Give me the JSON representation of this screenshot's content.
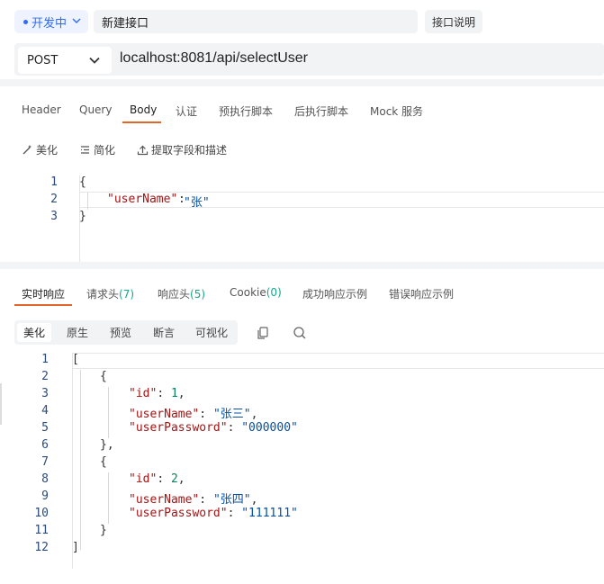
{
  "environment": {
    "label": "开发中",
    "accent": "#2f6cf6"
  },
  "request": {
    "name": "新建接口",
    "doc_label": "接口说明",
    "method": "POST",
    "url": "localhost:8081/api/selectUser"
  },
  "request_tabs": {
    "items": [
      "Header",
      "Query",
      "Body",
      "认证",
      "预执行脚本",
      "后执行脚本",
      "Mock 服务"
    ],
    "active": "Body",
    "accent": "#e0662a"
  },
  "body_toolbar": {
    "beautify": "美化",
    "simplify": "简化",
    "extract": "提取字段和描述"
  },
  "request_body": {
    "line_numbers": [
      "1",
      "2",
      "3"
    ],
    "open": "{",
    "key": "\"userName\"",
    "colon": ":",
    "value": "\"张\"",
    "close": "}"
  },
  "response_tabs": {
    "realtime": "实时响应",
    "req_headers": "请求头",
    "req_headers_count": "7",
    "res_headers": "响应头",
    "res_headers_count": "5",
    "cookie": "Cookie",
    "cookie_count": "0",
    "success_example": "成功响应示例",
    "error_example": "错误响应示例"
  },
  "view_modes": {
    "items": [
      "美化",
      "原生",
      "预览",
      "断言",
      "可视化"
    ],
    "active": "美化"
  },
  "response_body": {
    "line_numbers": [
      "1",
      "2",
      "3",
      "4",
      "5",
      "6",
      "7",
      "8",
      "9",
      "10",
      "11",
      "12"
    ],
    "lines": [
      [
        {
          "t": "p",
          "v": "["
        }
      ],
      [
        {
          "t": "p",
          "v": "{"
        }
      ],
      [
        {
          "t": "k",
          "v": "\"id\""
        },
        {
          "t": "p",
          "v": ": "
        },
        {
          "t": "n",
          "v": "1"
        },
        {
          "t": "p",
          "v": ","
        }
      ],
      [
        {
          "t": "k",
          "v": "\"userName\""
        },
        {
          "t": "p",
          "v": ": "
        },
        {
          "t": "s",
          "v": "\"张三\""
        },
        {
          "t": "p",
          "v": ","
        }
      ],
      [
        {
          "t": "k",
          "v": "\"userPassword\""
        },
        {
          "t": "p",
          "v": ": "
        },
        {
          "t": "s",
          "v": "\"000000\""
        }
      ],
      [
        {
          "t": "p",
          "v": "},"
        }
      ],
      [
        {
          "t": "p",
          "v": "{"
        }
      ],
      [
        {
          "t": "k",
          "v": "\"id\""
        },
        {
          "t": "p",
          "v": ": "
        },
        {
          "t": "n",
          "v": "2"
        },
        {
          "t": "p",
          "v": ","
        }
      ],
      [
        {
          "t": "k",
          "v": "\"userName\""
        },
        {
          "t": "p",
          "v": ": "
        },
        {
          "t": "s",
          "v": "\"张四\""
        },
        {
          "t": "p",
          "v": ","
        }
      ],
      [
        {
          "t": "k",
          "v": "\"userPassword\""
        },
        {
          "t": "p",
          "v": ": "
        },
        {
          "t": "s",
          "v": "\"111111\""
        }
      ],
      [
        {
          "t": "p",
          "v": "}"
        }
      ],
      [
        {
          "t": "p",
          "v": "]"
        }
      ]
    ]
  },
  "icons": {
    "env_chevron": "chevron-down-icon",
    "method_chevron": "chevron-down-icon",
    "beautify": "magic-wand-icon",
    "simplify": "list-icon",
    "extract": "upload-icon",
    "copy": "copy-icon",
    "search": "search-icon"
  }
}
